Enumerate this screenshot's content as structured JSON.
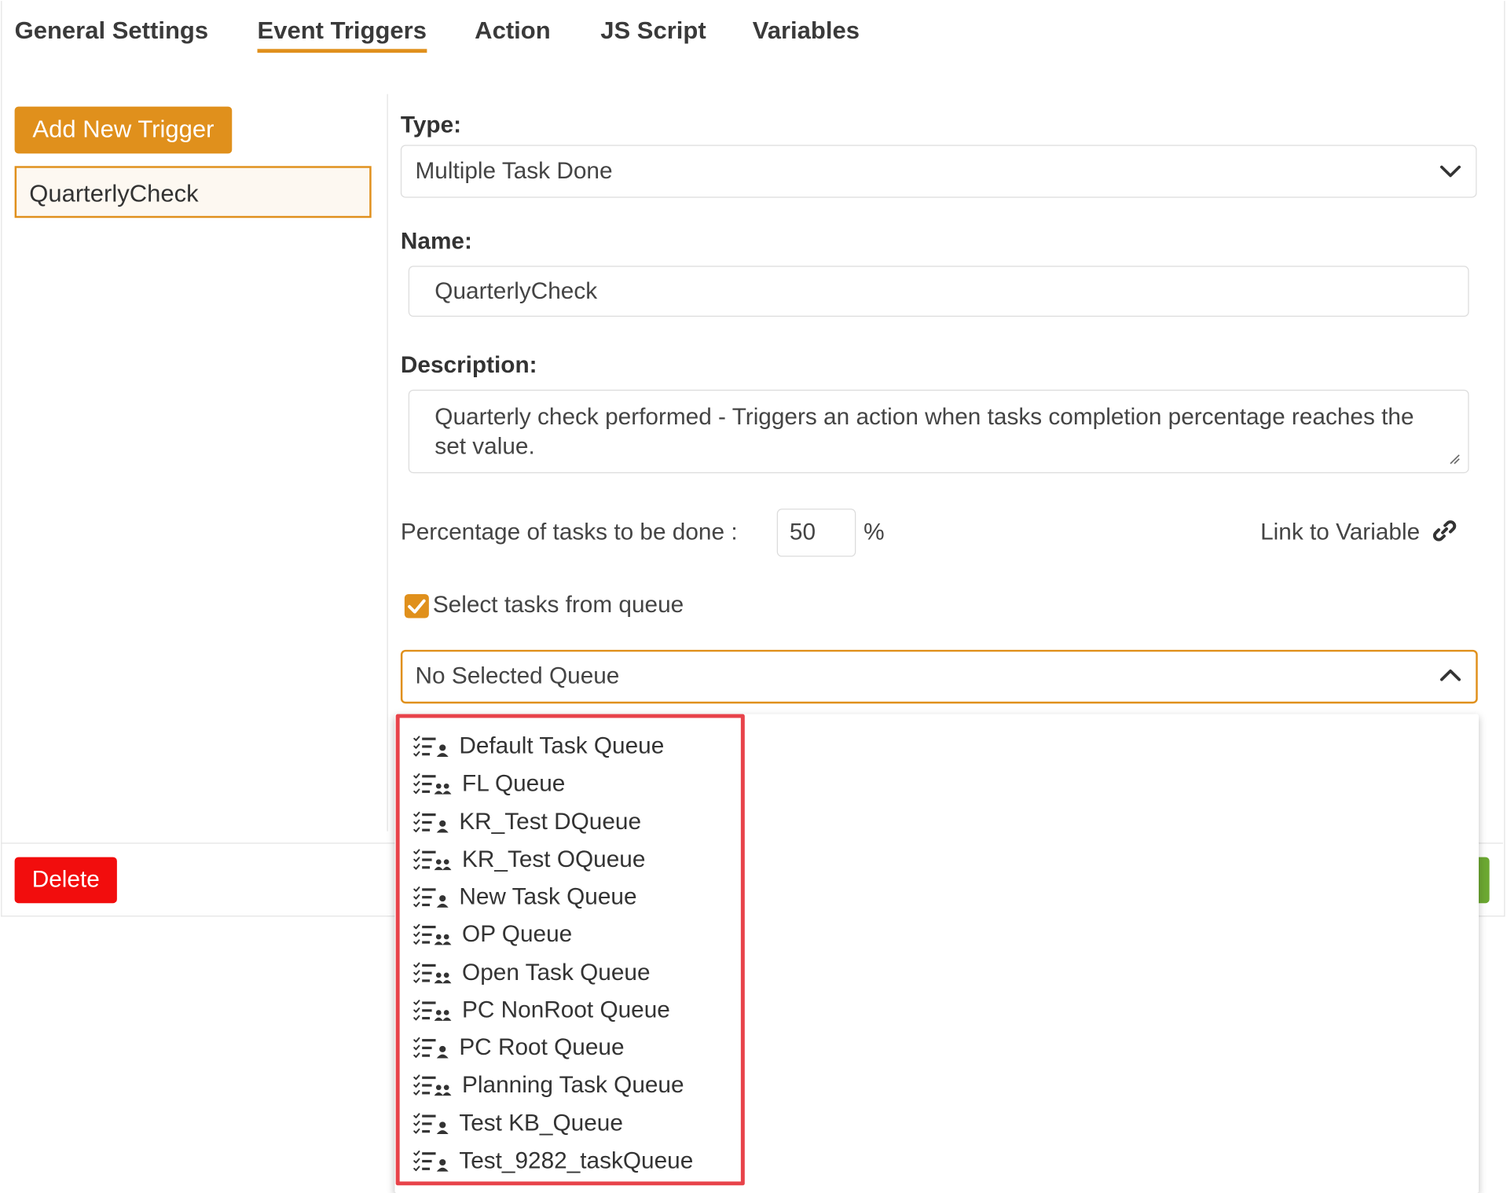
{
  "tabs": [
    {
      "label": "General Settings"
    },
    {
      "label": "Event Triggers"
    },
    {
      "label": "Action"
    },
    {
      "label": "JS Script"
    },
    {
      "label": "Variables"
    }
  ],
  "sidebar": {
    "add_button": "Add New Trigger",
    "triggers": [
      "QuarterlyCheck"
    ]
  },
  "form": {
    "type_label": "Type:",
    "type_value": "Multiple Task Done",
    "name_label": "Name:",
    "name_value": "QuarterlyCheck",
    "description_label": "Description:",
    "description_value": "Quarterly check performed - Triggers an action when tasks completion percentage reaches the set value.",
    "percentage_label": "Percentage of tasks to be done :",
    "percentage_value": "50",
    "percentage_unit": "%",
    "link_to_variable": "Link to Variable",
    "select_tasks_label": "Select tasks from queue",
    "select_tasks_checked": true,
    "queue_value": "No Selected Queue"
  },
  "queue_options": [
    {
      "label": "Default Task Queue",
      "icon": "task-queue-single-icon"
    },
    {
      "label": "FL Queue",
      "icon": "task-queue-group-icon"
    },
    {
      "label": "KR_Test DQueue",
      "icon": "task-queue-single-icon"
    },
    {
      "label": "KR_Test OQueue",
      "icon": "task-queue-group-icon"
    },
    {
      "label": "New Task Queue",
      "icon": "task-queue-single-icon"
    },
    {
      "label": "OP Queue",
      "icon": "task-queue-group-icon"
    },
    {
      "label": "Open Task Queue",
      "icon": "task-queue-group-icon"
    },
    {
      "label": "PC NonRoot Queue",
      "icon": "task-queue-group-icon"
    },
    {
      "label": "PC Root Queue",
      "icon": "task-queue-single-icon"
    },
    {
      "label": "Planning Task Queue",
      "icon": "task-queue-group-icon"
    },
    {
      "label": "Test KB_Queue",
      "icon": "task-queue-single-icon"
    },
    {
      "label": "Test_9282_taskQueue",
      "icon": "task-queue-single-icon"
    }
  ],
  "footer": {
    "delete_button": "Delete"
  },
  "colors": {
    "accent": "#e0901c",
    "danger": "#f20d0d",
    "highlight": "#e8434a",
    "save": "#6ca832"
  }
}
